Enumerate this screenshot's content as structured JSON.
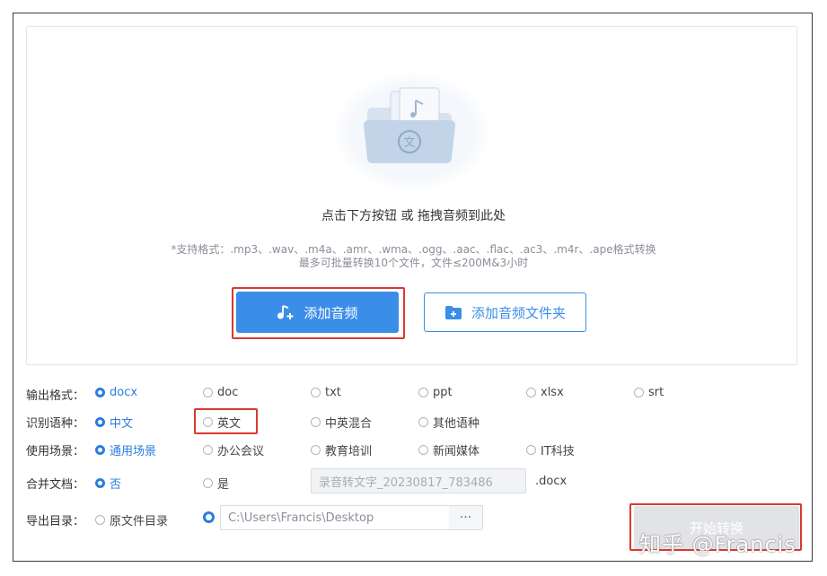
{
  "upload": {
    "prompt": "点击下方按钮 或 拖拽音频到此处",
    "formats_hint": "*支持格式：.mp3、.wav、.m4a、.amr、.wma、.ogg、.aac、.flac、.ac3、.m4r、.ape格式转换",
    "limit_hint": "最多可批量转换10个文件，文件≤200M&3小时",
    "add_audio_label": "添加音频",
    "add_folder_label": "添加音频文件夹"
  },
  "output_format": {
    "label": "输出格式：",
    "options": [
      "docx",
      "doc",
      "txt",
      "ppt",
      "xlsx",
      "srt"
    ],
    "selected": "docx"
  },
  "language": {
    "label": "识别语种：",
    "options": [
      "中文",
      "英文",
      "中英混合",
      "其他语种"
    ],
    "selected": "中文"
  },
  "scene": {
    "label": "使用场景：",
    "options": [
      "通用场景",
      "办公会议",
      "教育培训",
      "新闻媒体",
      "IT科技"
    ],
    "selected": "通用场景"
  },
  "merge": {
    "label": "合并文档：",
    "options": [
      "否",
      "是"
    ],
    "selected": "否",
    "filename": "录音转文字_20230817_783486",
    "ext": ".docx"
  },
  "export": {
    "label": "导出目录：",
    "options": [
      "原文件目录",
      ""
    ],
    "selected_index": 1,
    "path": "C:\\Users\\Francis\\Desktop",
    "browse_label": "···"
  },
  "start_label": "开始转换",
  "watermark": "知乎 @Francis",
  "colors": {
    "accent": "#3b8ee8",
    "highlight_box": "#d93a30",
    "disabled_button": "#e2e3e6"
  },
  "icons": {
    "upload": "folder-document-icon",
    "add_audio": "music-note-plus-icon",
    "add_folder": "folder-plus-icon"
  }
}
